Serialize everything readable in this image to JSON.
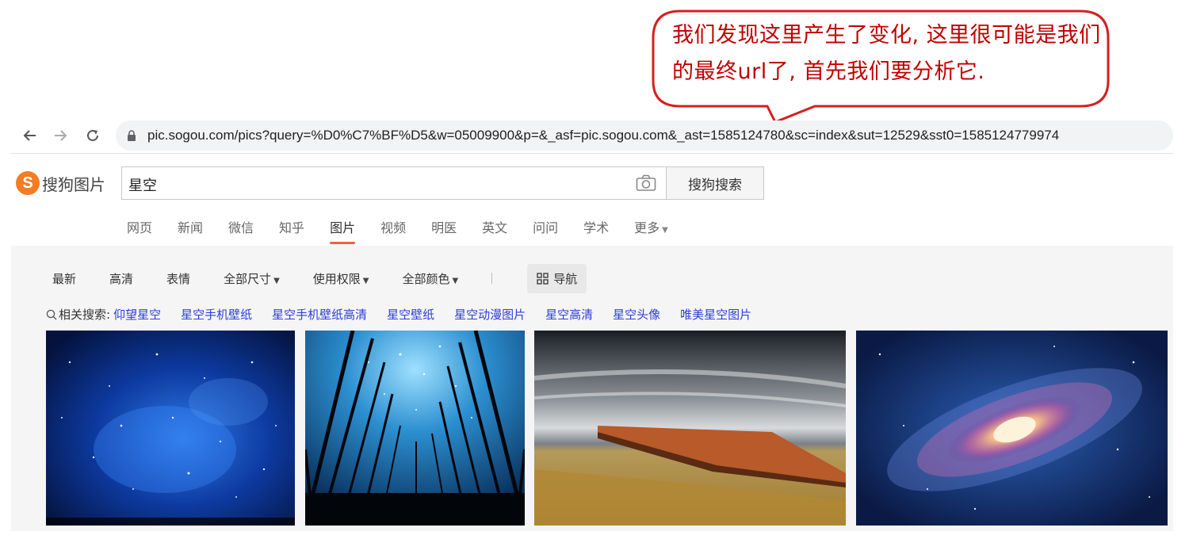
{
  "annotation": {
    "text": "我们发现这里产生了变化, 这里很可能是我们的最终url了, 首先我们要分析它.",
    "color": "#c00000"
  },
  "browser": {
    "back_icon": "arrow-left-icon",
    "forward_icon": "arrow-right-icon",
    "reload_icon": "reload-icon",
    "url": "pic.sogou.com/pics?query=%D0%C7%BF%D5&w=05009900&p=&_asf=pic.sogou.com&_ast=1585124780&sc=index&sut=12529&sst0=1585124779974"
  },
  "header": {
    "logo_letter": "S",
    "logo_text": "搜狗图片",
    "logo_color": "#f57c22",
    "search_value": "星空",
    "search_button": "搜狗搜索"
  },
  "tabs": [
    {
      "label": "网页"
    },
    {
      "label": "新闻"
    },
    {
      "label": "微信"
    },
    {
      "label": "知乎"
    },
    {
      "label": "图片",
      "active": true
    },
    {
      "label": "视频"
    },
    {
      "label": "明医"
    },
    {
      "label": "英文"
    },
    {
      "label": "问问"
    },
    {
      "label": "学术"
    },
    {
      "label": "更多"
    }
  ],
  "filters": {
    "latest": "最新",
    "hd": "高清",
    "emoji": "表情",
    "size": "全部尺寸",
    "rights": "使用权限",
    "color": "全部颜色",
    "guide": "导航"
  },
  "related": {
    "label": "相关搜索:",
    "items": [
      "仰望星空",
      "星空手机壁纸",
      "星空手机壁纸高清",
      "星空壁纸",
      "星空动漫图片",
      "星空高清",
      "星空头像",
      "唯美星空图片"
    ]
  },
  "images": [
    {
      "subject": "blue starry nebula"
    },
    {
      "subject": "trees under starry sky"
    },
    {
      "subject": "pier in long exposure seascape"
    },
    {
      "subject": "spiral galaxy"
    }
  ]
}
